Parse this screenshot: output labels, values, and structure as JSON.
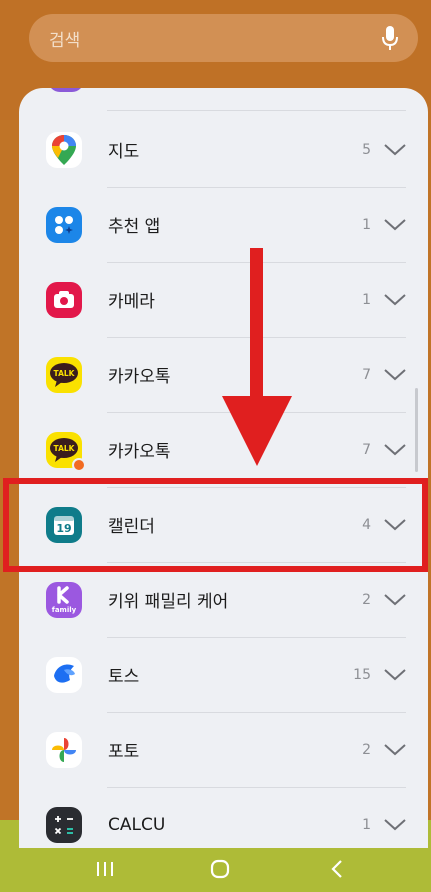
{
  "search": {
    "placeholder": "검색"
  },
  "apps": [
    {
      "label": "지도",
      "count": "5",
      "icon": "google-maps-icon"
    },
    {
      "label": "추천 앱",
      "count": "1",
      "icon": "recommended-apps-icon"
    },
    {
      "label": "카메라",
      "count": "1",
      "icon": "camera-icon"
    },
    {
      "label": "카카오톡",
      "count": "7",
      "icon": "kakaotalk-icon",
      "badge": "TALK"
    },
    {
      "label": "카카오톡",
      "count": "7",
      "icon": "kakaotalk-dual-icon",
      "badge": "TALK"
    },
    {
      "label": "캘린더",
      "count": "4",
      "icon": "calendar-icon",
      "badge": "19"
    },
    {
      "label": "키위 패밀리 케어",
      "count": "2",
      "icon": "kiwi-family-icon",
      "badge": "family"
    },
    {
      "label": "토스",
      "count": "15",
      "icon": "toss-icon"
    },
    {
      "label": "포토",
      "count": "2",
      "icon": "google-photos-icon"
    },
    {
      "label": "CALCU",
      "count": "1",
      "icon": "calculator-icon"
    }
  ],
  "colors": {
    "top_background": "#bf7126",
    "bottom_background": "#aebb37",
    "panel": "#eef0f4",
    "annotation_red": "#e01f1f"
  },
  "nav": {
    "buttons": [
      "recent-apps",
      "home",
      "back"
    ]
  }
}
